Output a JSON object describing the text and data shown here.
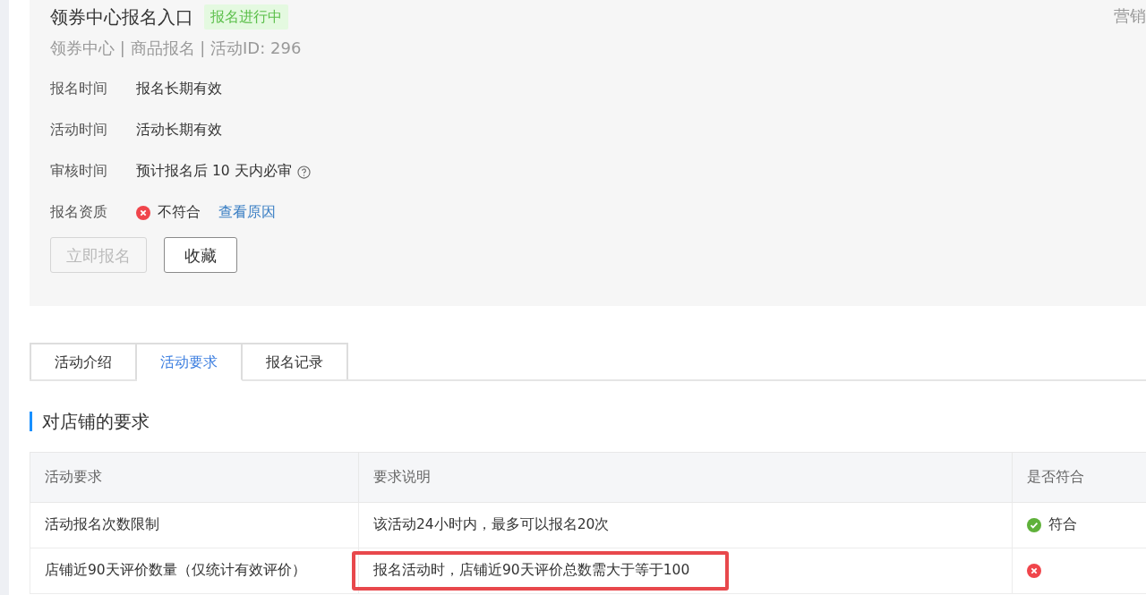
{
  "header": {
    "title": "领券中心报名入口",
    "status_badge": "报名进行中",
    "subtitle": "领券中心 | 商品报名 | 活动ID: 296",
    "corner_text": "营销"
  },
  "info_rows": [
    {
      "kind": "text",
      "label": "报名时间",
      "value": "报名长期有效"
    },
    {
      "kind": "text",
      "label": "活动时间",
      "value": "活动长期有效"
    },
    {
      "kind": "help",
      "label": "审核时间",
      "value": "预计报名后 10 天内必审"
    },
    {
      "kind": "status",
      "label": "报名资质",
      "value": "不符合",
      "passed": false,
      "link": "查看原因"
    }
  ],
  "buttons": [
    {
      "label": "立即报名",
      "disabled": true
    },
    {
      "label": "收藏",
      "disabled": false
    }
  ],
  "tabs": [
    {
      "label": "活动介绍",
      "selected": false
    },
    {
      "label": "活动要求",
      "selected": true
    },
    {
      "label": "报名记录",
      "selected": false
    }
  ],
  "section_title": "对店铺的要求",
  "table": {
    "columns": [
      "活动要求",
      "要求说明",
      "是否符合"
    ],
    "rows": [
      {
        "requirement": "活动报名次数限制",
        "description": "该活动24小时内，最多可以报名20次",
        "passed": true,
        "result": "符合",
        "highlighted": false
      },
      {
        "requirement": "店铺近90天评价数量（仅统计有效评价）",
        "description": "报名活动时，店铺近90天评价总数需大于等于100",
        "passed": false,
        "highlighted": true
      }
    ]
  }
}
